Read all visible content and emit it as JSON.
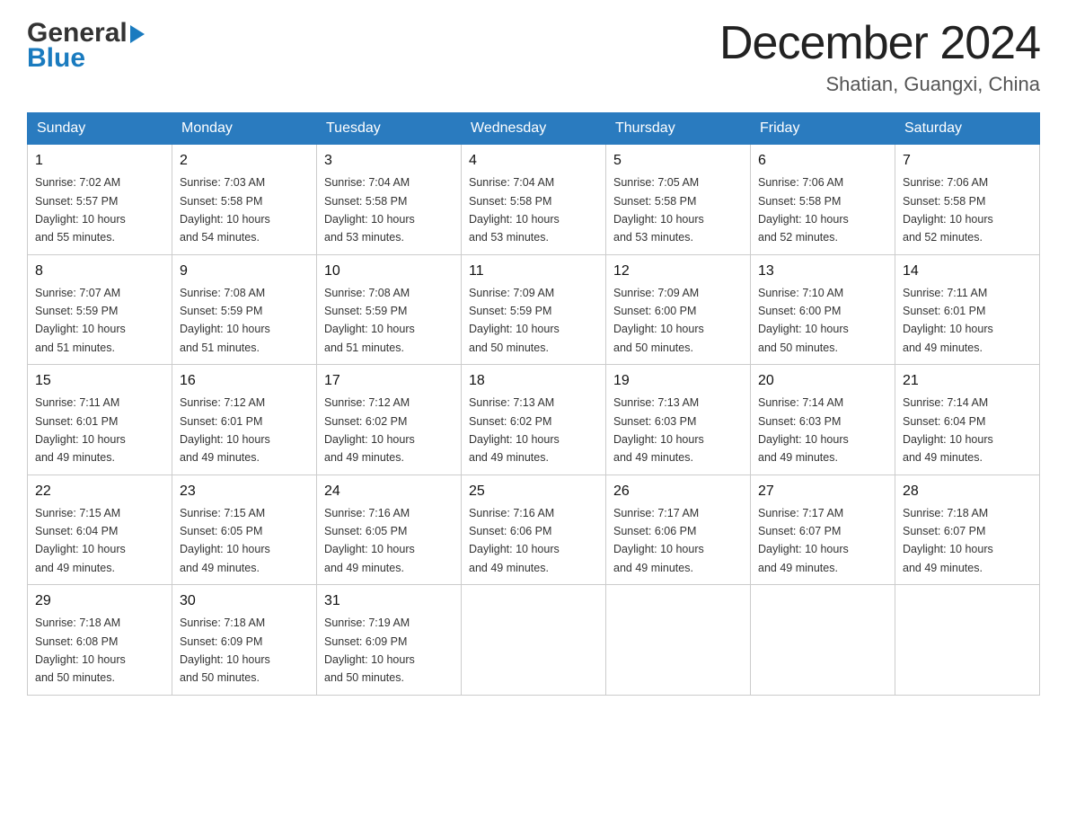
{
  "header": {
    "month_title": "December 2024",
    "location": "Shatian, Guangxi, China",
    "logo_general": "General",
    "logo_blue": "Blue"
  },
  "days_of_week": [
    "Sunday",
    "Monday",
    "Tuesday",
    "Wednesday",
    "Thursday",
    "Friday",
    "Saturday"
  ],
  "weeks": [
    [
      {
        "day": "1",
        "sunrise": "7:02 AM",
        "sunset": "5:57 PM",
        "daylight": "10 hours and 55 minutes."
      },
      {
        "day": "2",
        "sunrise": "7:03 AM",
        "sunset": "5:58 PM",
        "daylight": "10 hours and 54 minutes."
      },
      {
        "day": "3",
        "sunrise": "7:04 AM",
        "sunset": "5:58 PM",
        "daylight": "10 hours and 53 minutes."
      },
      {
        "day": "4",
        "sunrise": "7:04 AM",
        "sunset": "5:58 PM",
        "daylight": "10 hours and 53 minutes."
      },
      {
        "day": "5",
        "sunrise": "7:05 AM",
        "sunset": "5:58 PM",
        "daylight": "10 hours and 53 minutes."
      },
      {
        "day": "6",
        "sunrise": "7:06 AM",
        "sunset": "5:58 PM",
        "daylight": "10 hours and 52 minutes."
      },
      {
        "day": "7",
        "sunrise": "7:06 AM",
        "sunset": "5:58 PM",
        "daylight": "10 hours and 52 minutes."
      }
    ],
    [
      {
        "day": "8",
        "sunrise": "7:07 AM",
        "sunset": "5:59 PM",
        "daylight": "10 hours and 51 minutes."
      },
      {
        "day": "9",
        "sunrise": "7:08 AM",
        "sunset": "5:59 PM",
        "daylight": "10 hours and 51 minutes."
      },
      {
        "day": "10",
        "sunrise": "7:08 AM",
        "sunset": "5:59 PM",
        "daylight": "10 hours and 51 minutes."
      },
      {
        "day": "11",
        "sunrise": "7:09 AM",
        "sunset": "5:59 PM",
        "daylight": "10 hours and 50 minutes."
      },
      {
        "day": "12",
        "sunrise": "7:09 AM",
        "sunset": "6:00 PM",
        "daylight": "10 hours and 50 minutes."
      },
      {
        "day": "13",
        "sunrise": "7:10 AM",
        "sunset": "6:00 PM",
        "daylight": "10 hours and 50 minutes."
      },
      {
        "day": "14",
        "sunrise": "7:11 AM",
        "sunset": "6:01 PM",
        "daylight": "10 hours and 49 minutes."
      }
    ],
    [
      {
        "day": "15",
        "sunrise": "7:11 AM",
        "sunset": "6:01 PM",
        "daylight": "10 hours and 49 minutes."
      },
      {
        "day": "16",
        "sunrise": "7:12 AM",
        "sunset": "6:01 PM",
        "daylight": "10 hours and 49 minutes."
      },
      {
        "day": "17",
        "sunrise": "7:12 AM",
        "sunset": "6:02 PM",
        "daylight": "10 hours and 49 minutes."
      },
      {
        "day": "18",
        "sunrise": "7:13 AM",
        "sunset": "6:02 PM",
        "daylight": "10 hours and 49 minutes."
      },
      {
        "day": "19",
        "sunrise": "7:13 AM",
        "sunset": "6:03 PM",
        "daylight": "10 hours and 49 minutes."
      },
      {
        "day": "20",
        "sunrise": "7:14 AM",
        "sunset": "6:03 PM",
        "daylight": "10 hours and 49 minutes."
      },
      {
        "day": "21",
        "sunrise": "7:14 AM",
        "sunset": "6:04 PM",
        "daylight": "10 hours and 49 minutes."
      }
    ],
    [
      {
        "day": "22",
        "sunrise": "7:15 AM",
        "sunset": "6:04 PM",
        "daylight": "10 hours and 49 minutes."
      },
      {
        "day": "23",
        "sunrise": "7:15 AM",
        "sunset": "6:05 PM",
        "daylight": "10 hours and 49 minutes."
      },
      {
        "day": "24",
        "sunrise": "7:16 AM",
        "sunset": "6:05 PM",
        "daylight": "10 hours and 49 minutes."
      },
      {
        "day": "25",
        "sunrise": "7:16 AM",
        "sunset": "6:06 PM",
        "daylight": "10 hours and 49 minutes."
      },
      {
        "day": "26",
        "sunrise": "7:17 AM",
        "sunset": "6:06 PM",
        "daylight": "10 hours and 49 minutes."
      },
      {
        "day": "27",
        "sunrise": "7:17 AM",
        "sunset": "6:07 PM",
        "daylight": "10 hours and 49 minutes."
      },
      {
        "day": "28",
        "sunrise": "7:18 AM",
        "sunset": "6:07 PM",
        "daylight": "10 hours and 49 minutes."
      }
    ],
    [
      {
        "day": "29",
        "sunrise": "7:18 AM",
        "sunset": "6:08 PM",
        "daylight": "10 hours and 50 minutes."
      },
      {
        "day": "30",
        "sunrise": "7:18 AM",
        "sunset": "6:09 PM",
        "daylight": "10 hours and 50 minutes."
      },
      {
        "day": "31",
        "sunrise": "7:19 AM",
        "sunset": "6:09 PM",
        "daylight": "10 hours and 50 minutes."
      },
      null,
      null,
      null,
      null
    ]
  ],
  "labels": {
    "sunrise": "Sunrise:",
    "sunset": "Sunset:",
    "daylight": "Daylight:"
  }
}
